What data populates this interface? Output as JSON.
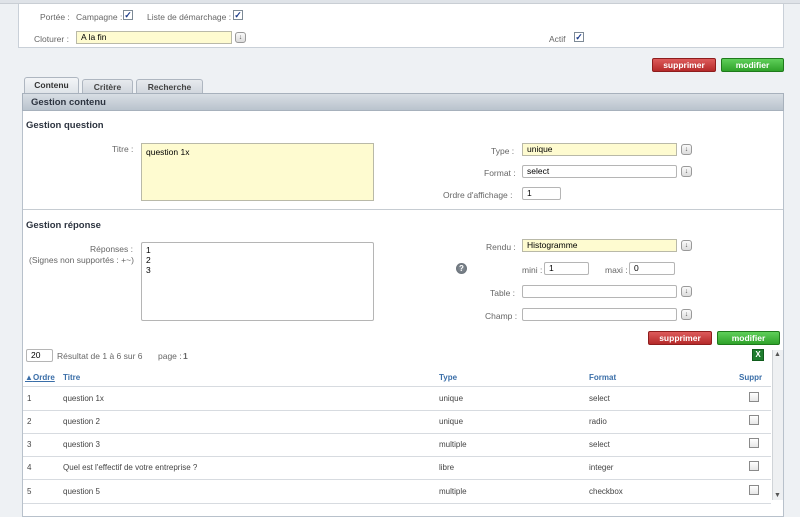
{
  "top": {
    "portee_label": "Portée :",
    "campagne_label": "Campagne :",
    "campagne_checked": true,
    "liste_label": "Liste de démarchage :",
    "liste_checked": true,
    "cloturer_label": "Cloturer :",
    "cloturer_value": "A la fin",
    "actif_label": "Actif",
    "actif_checked": true
  },
  "actions": {
    "delete_label": "supprimer",
    "modify_label": "modifier"
  },
  "tabs": [
    {
      "label": "Contenu",
      "active": true
    },
    {
      "label": "Critère",
      "active": false
    },
    {
      "label": "Recherche",
      "active": false
    }
  ],
  "panel": {
    "title": "Gestion contenu",
    "question": {
      "section_title": "Gestion question",
      "titre_label": "Titre :",
      "titre_value": "question 1x",
      "type_label": "Type :",
      "type_value": "unique",
      "format_label": "Format :",
      "format_value": "select",
      "ordre_label": "Ordre d'affichage :",
      "ordre_value": "1"
    },
    "reponse": {
      "section_title": "Gestion réponse",
      "reponses_label": "Réponses :",
      "signes_note": "(Signes non supportés : +~)",
      "reponses_lines": [
        "1",
        "2",
        "3"
      ],
      "help_glyph": "?",
      "rendu_label": "Rendu :",
      "rendu_value": "Histogramme",
      "mini_label": "mini :",
      "mini_value": "1",
      "maxi_label": "maxi :",
      "maxi_value": "0",
      "table_label": "Table :",
      "table_value": "",
      "champ_label": "Champ :",
      "champ_value": ""
    }
  },
  "list": {
    "page_size": "20",
    "result_text": "Résultat de 1 à 6 sur 6",
    "page_label": "page :",
    "page_number": "1",
    "export_icon": "excel-icon",
    "export_glyph": "X",
    "columns": {
      "ordre": "Ordre",
      "titre": "Titre",
      "type": "Type",
      "format": "Format",
      "suppr": "Suppr"
    },
    "rows": [
      {
        "ordre": "1",
        "titre": "question 1x",
        "type": "unique",
        "format": "select"
      },
      {
        "ordre": "2",
        "titre": "question 2",
        "type": "unique",
        "format": "radio"
      },
      {
        "ordre": "3",
        "titre": "question 3",
        "type": "multiple",
        "format": "select"
      },
      {
        "ordre": "4",
        "titre": "Quel est l'effectif de votre entreprise ?",
        "type": "libre",
        "format": "integer"
      },
      {
        "ordre": "5",
        "titre": "question 5",
        "type": "multiple",
        "format": "checkbox"
      }
    ]
  },
  "colors": {
    "highlight_input": "#fefbd0",
    "delete": "#c33a3a",
    "modify": "#3aae35",
    "link": "#3a6ea8"
  }
}
